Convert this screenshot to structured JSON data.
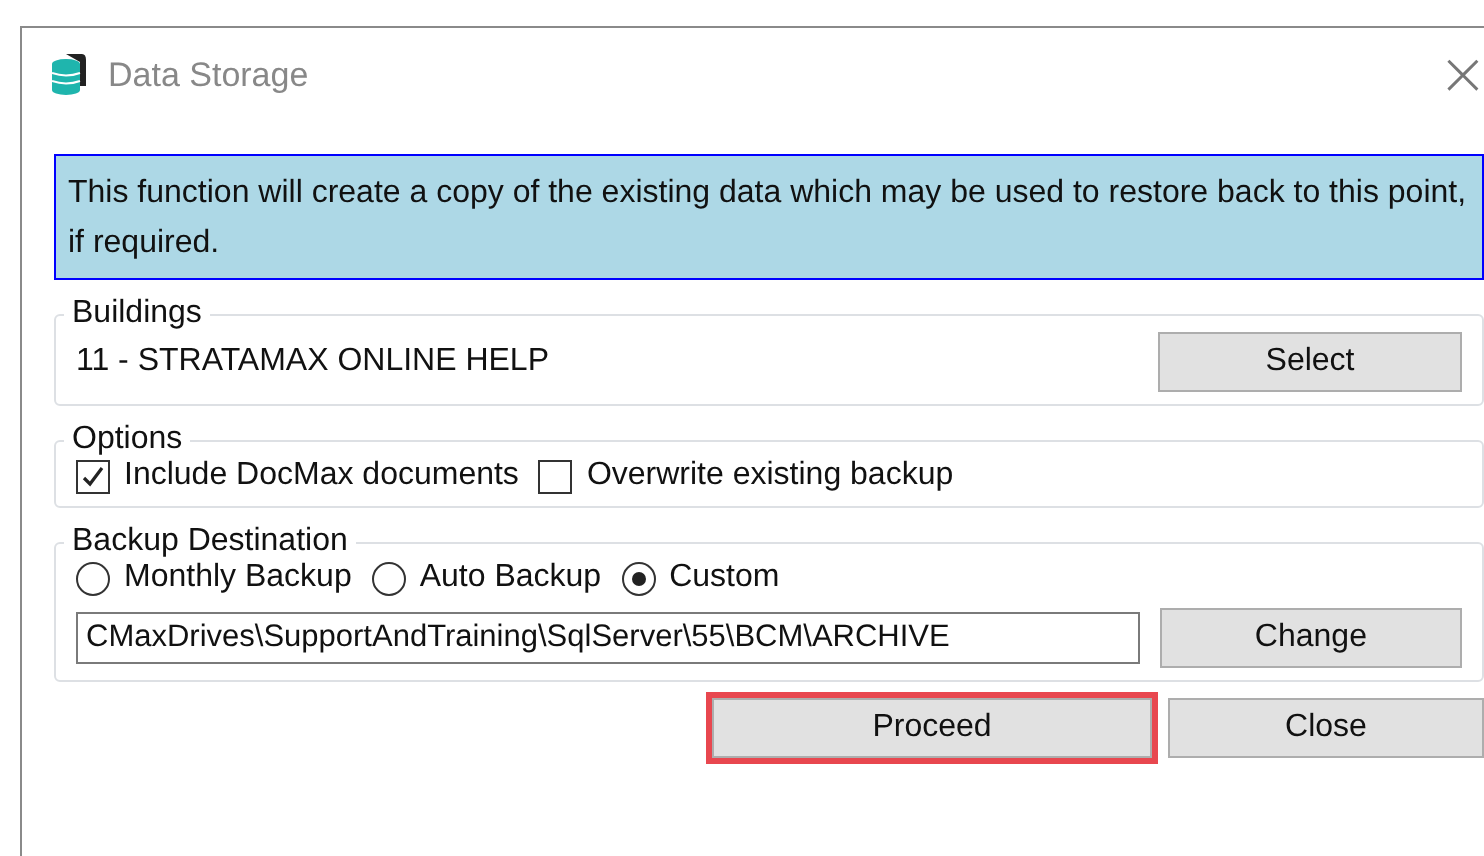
{
  "window": {
    "title": "Data Storage",
    "close": "×"
  },
  "info": "This function will create a copy of the existing data which may be used to restore back to this point, if required.",
  "buildings": {
    "legend": "Buildings",
    "value": "11 - STRATAMAX ONLINE HELP",
    "button": "Select"
  },
  "options": {
    "legend": "Options",
    "items": [
      {
        "label": "Include DocMax documents",
        "checked": true
      },
      {
        "label": "Overwrite existing backup",
        "checked": false
      }
    ]
  },
  "backup": {
    "legend": "Backup Destination",
    "radios": [
      {
        "label": "Monthly Backup",
        "selected": false
      },
      {
        "label": "Auto Backup",
        "selected": false
      },
      {
        "label": "Custom",
        "selected": true
      }
    ],
    "path": "CMaxDrives\\SupportAndTraining\\SqlServer\\55\\BCM\\ARCHIVE",
    "button": "Change"
  },
  "buttons": [
    {
      "label": "Proceed",
      "highlighted": true
    },
    {
      "label": "Close",
      "highlighted": false
    }
  ]
}
